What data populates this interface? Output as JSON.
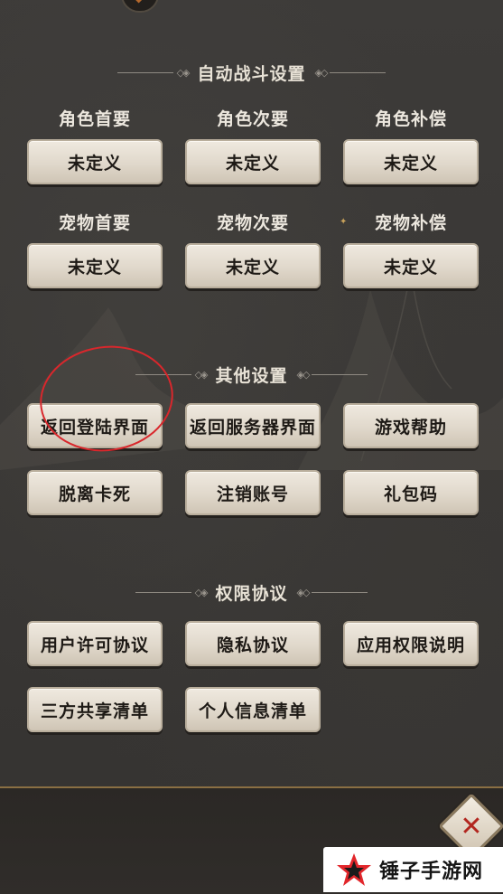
{
  "sections": {
    "auto_battle": {
      "title": "自动战斗设置",
      "role_primary_label": "角色首要",
      "role_secondary_label": "角色次要",
      "role_backup_label": "角色补偿",
      "pet_primary_label": "宠物首要",
      "pet_secondary_label": "宠物次要",
      "pet_backup_label": "宠物补偿",
      "undefined_value": "未定义"
    },
    "other": {
      "title": "其他设置",
      "buttons": [
        "返回登陆界面",
        "返回服务器界面",
        "游戏帮助",
        "脱离卡死",
        "注销账号",
        "礼包码"
      ]
    },
    "permissions": {
      "title": "权限协议",
      "buttons": [
        "用户许可协议",
        "隐私协议",
        "应用权限说明",
        "三方共享清单",
        "个人信息清单"
      ]
    }
  },
  "close_glyph": "✕",
  "watermark": {
    "text": "锤子手游网"
  },
  "colors": {
    "annotation_circle": "#d9272c",
    "button_face": "#e6dfd3",
    "close_x": "#b2261f",
    "accent_gold": "#8a6f43"
  },
  "icons": [
    "top-emblem-icon",
    "close-icon",
    "watermark-star-icon",
    "ornament-icon",
    "sparkle-icon"
  ]
}
